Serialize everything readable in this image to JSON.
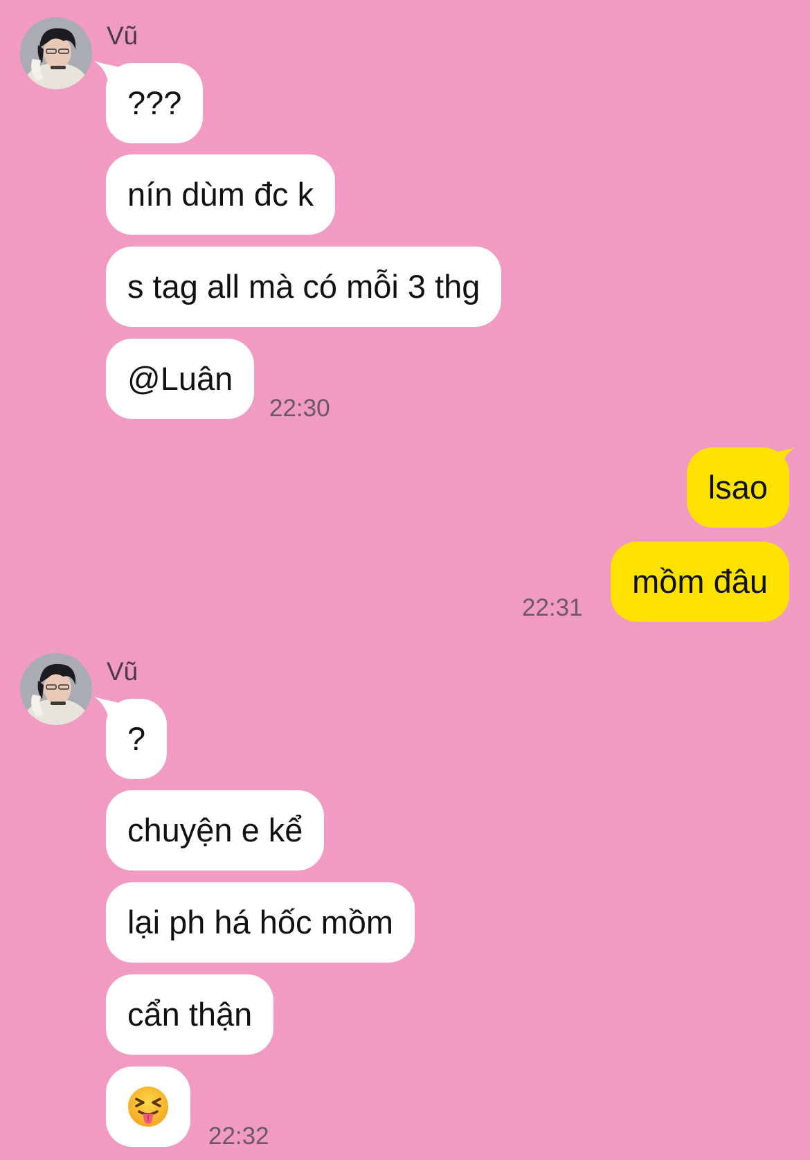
{
  "theme": {
    "background": "#f29bc2",
    "incoming_bubble": "#ffffff",
    "outgoing_bubble": "#fde200"
  },
  "groups": [
    {
      "sender": "Vũ",
      "avatar_icon": "profile-photo",
      "messages": [
        "???",
        "nín dùm đc k",
        "s tag all mà có mỗi 3 thg",
        "@Luân"
      ],
      "time": "22:30"
    },
    {
      "messages": [
        "lsao",
        "mồm đâu"
      ],
      "time": "22:31"
    },
    {
      "sender": "Vũ",
      "avatar_icon": "profile-photo",
      "messages": [
        "?",
        "chuyện e kể",
        "lại ph há hốc mồm",
        "cẩn thận"
      ],
      "emoji_icon": "squinting-face-with-tongue-emoji",
      "time": "22:32"
    }
  ]
}
